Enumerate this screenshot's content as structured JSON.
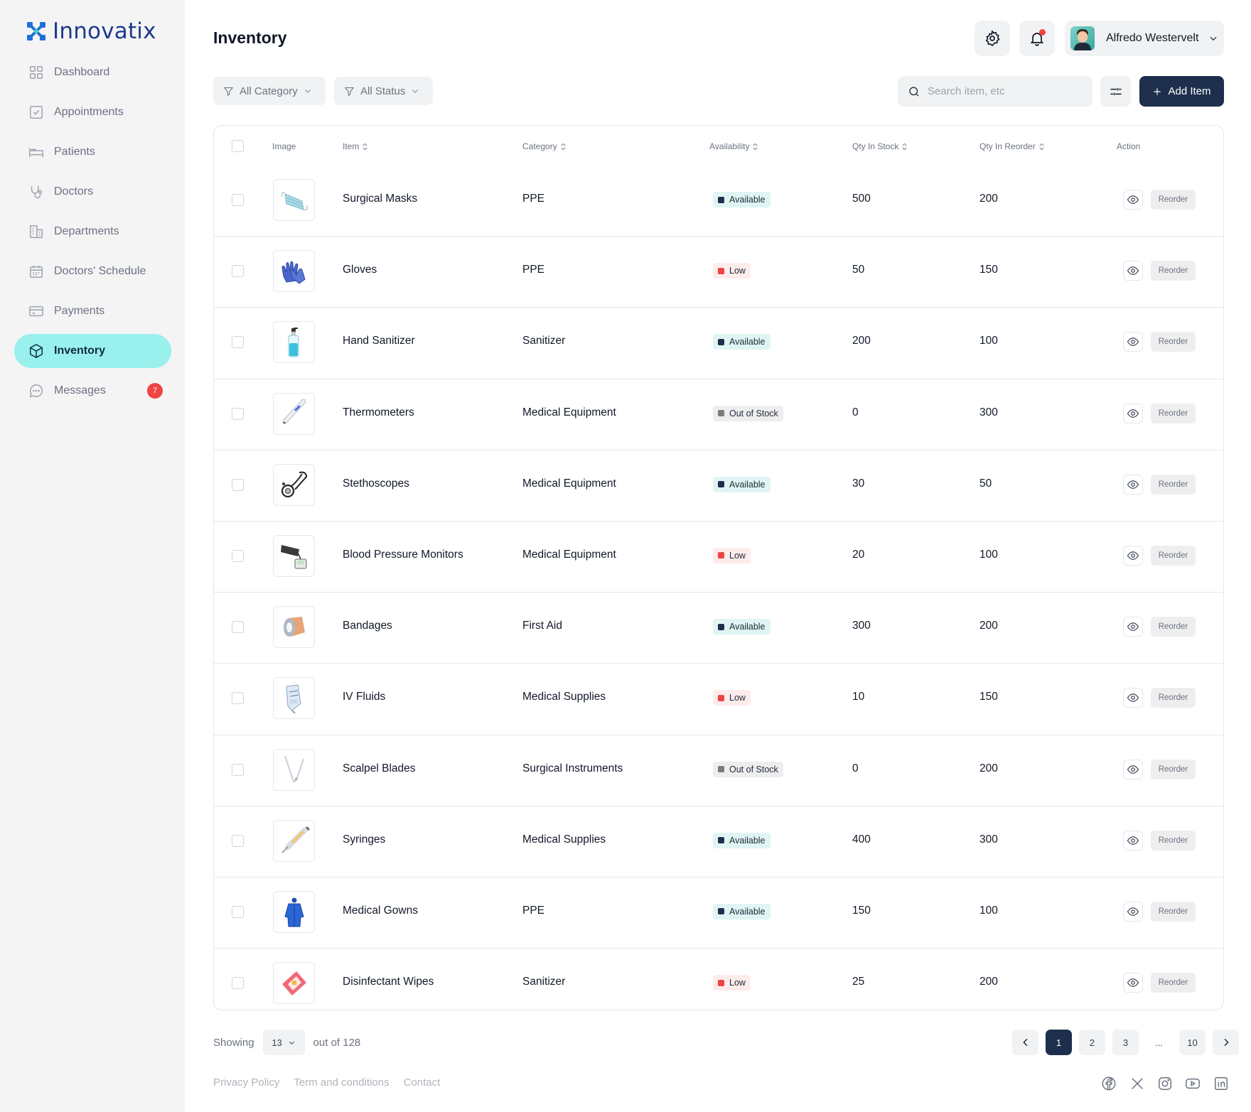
{
  "brand": {
    "name": "Innovatix"
  },
  "sidebar": {
    "items": [
      {
        "label": "Dashboard",
        "icon": "grid-icon"
      },
      {
        "label": "Appointments",
        "icon": "checkbox-icon"
      },
      {
        "label": "Patients",
        "icon": "bed-icon"
      },
      {
        "label": "Doctors",
        "icon": "stethoscope-icon"
      },
      {
        "label": "Departments",
        "icon": "building-icon"
      },
      {
        "label": "Doctors' Schedule",
        "icon": "calendar-icon"
      },
      {
        "label": "Payments",
        "icon": "card-icon"
      },
      {
        "label": "Inventory",
        "icon": "box-icon",
        "active": true
      },
      {
        "label": "Messages",
        "icon": "chat-icon",
        "badge": "7"
      }
    ]
  },
  "header": {
    "title": "Inventory",
    "user_name": "Alfredo Westervelt"
  },
  "toolbar": {
    "category_filter": "All Category",
    "status_filter": "All Status",
    "search_placeholder": "Search item, etc",
    "add_label": "Add Item"
  },
  "table": {
    "columns": {
      "image": "Image",
      "item": "Item",
      "category": "Category",
      "availability": "Availability",
      "qty_stock": "Qty In Stock",
      "qty_reorder": "Qty In Reorder",
      "action": "Action"
    },
    "action_label": "Reorder",
    "rows": [
      {
        "item": "Surgical Masks",
        "category": "PPE",
        "status": "Available",
        "status_type": "available",
        "stock": "500",
        "reorder": "200",
        "image_icon": "mask-icon"
      },
      {
        "item": "Gloves",
        "category": "PPE",
        "status": "Low",
        "status_type": "low",
        "stock": "50",
        "reorder": "150",
        "image_icon": "gloves-icon"
      },
      {
        "item": "Hand Sanitizer",
        "category": "Sanitizer",
        "status": "Available",
        "status_type": "available",
        "stock": "200",
        "reorder": "100",
        "image_icon": "sanitizer-icon"
      },
      {
        "item": "Thermometers",
        "category": "Medical Equipment",
        "status": "Out of Stock",
        "status_type": "out",
        "stock": "0",
        "reorder": "300",
        "image_icon": "thermometer-icon"
      },
      {
        "item": "Stethoscopes",
        "category": "Medical Equipment",
        "status": "Available",
        "status_type": "available",
        "stock": "30",
        "reorder": "50",
        "image_icon": "stethoscope-icon"
      },
      {
        "item": "Blood Pressure Monitors",
        "category": "Medical Equipment",
        "status": "Low",
        "status_type": "low",
        "stock": "20",
        "reorder": "100",
        "image_icon": "bp-monitor-icon"
      },
      {
        "item": "Bandages",
        "category": "First Aid",
        "status": "Available",
        "status_type": "available",
        "stock": "300",
        "reorder": "200",
        "image_icon": "bandage-icon"
      },
      {
        "item": "IV Fluids",
        "category": "Medical Supplies",
        "status": "Low",
        "status_type": "low",
        "stock": "10",
        "reorder": "150",
        "image_icon": "iv-bag-icon"
      },
      {
        "item": "Scalpel Blades",
        "category": "Surgical Instruments",
        "status": "Out of Stock",
        "status_type": "out",
        "stock": "0",
        "reorder": "200",
        "image_icon": "scalpel-icon"
      },
      {
        "item": "Syringes",
        "category": "Medical Supplies",
        "status": "Available",
        "status_type": "available",
        "stock": "400",
        "reorder": "300",
        "image_icon": "syringe-icon"
      },
      {
        "item": "Medical Gowns",
        "category": "PPE",
        "status": "Available",
        "status_type": "available",
        "stock": "150",
        "reorder": "100",
        "image_icon": "gown-icon"
      },
      {
        "item": "Disinfectant Wipes",
        "category": "Sanitizer",
        "status": "Low",
        "status_type": "low",
        "stock": "25",
        "reorder": "200",
        "image_icon": "wipes-icon"
      }
    ]
  },
  "pagination": {
    "showing_label": "Showing",
    "page_size": "13",
    "total_label": "out of 128",
    "pages": [
      "1",
      "2",
      "3",
      "...",
      "10"
    ],
    "current": "1"
  },
  "footer": {
    "links": [
      "Privacy Policy",
      "Term and conditions",
      "Contact"
    ],
    "social": [
      "facebook-icon",
      "x-icon",
      "instagram-icon",
      "youtube-icon",
      "linkedin-icon"
    ]
  },
  "colors": {
    "primary": "#1e2f4d",
    "active_nav": "#99f0ec",
    "danger": "#ef4444",
    "available_bg": "#e0f5f3",
    "low_bg": "#fdecec",
    "out_bg": "#eeeeef"
  }
}
